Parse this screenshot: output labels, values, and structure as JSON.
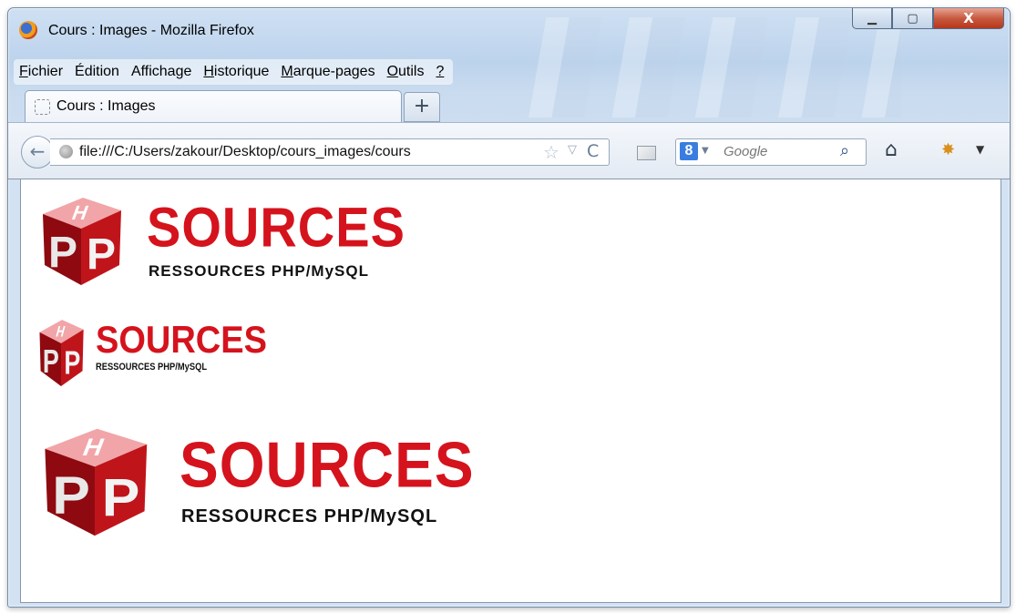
{
  "window": {
    "title": "Cours : Images - Mozilla Firefox",
    "minimize_symbol": "▁",
    "maximize_symbol": "▢",
    "close_symbol": "X"
  },
  "menubar": {
    "items": [
      {
        "label_u": "F",
        "label_rest": "ichier"
      },
      {
        "label_u": "É",
        "label_rest": "dition"
      },
      {
        "label_u": "A",
        "label_rest": "ffichage"
      },
      {
        "label_u": "H",
        "label_rest": "istorique"
      },
      {
        "label_u": "M",
        "label_rest": "arque-pages"
      },
      {
        "label_u": "O",
        "label_rest": "utils"
      },
      {
        "label_u": "?",
        "label_rest": ""
      }
    ]
  },
  "tab": {
    "label": "Cours : Images",
    "new_tab_symbol": "+"
  },
  "navbar": {
    "url": "file:///C:/Users/zakour/Desktop/cours_images/cours",
    "search_engine_letter": "8",
    "search_placeholder": "Google",
    "back_symbol": "←",
    "star_symbol": "☆",
    "dropdown_symbol": "▽",
    "reload_symbol": "C",
    "search_symbol": "⚲",
    "home_symbol": "⌂"
  },
  "content": {
    "logos": [
      {
        "letter_left": "P",
        "letter_right": "P",
        "letter_top": "H",
        "brand": "SOURCES",
        "tagline": "RESSOURCES PHP/MySQL"
      },
      {
        "letter_left": "P",
        "letter_right": "P",
        "letter_top": "H",
        "brand": "SOURCES",
        "tagline": "RESSOURCES PHP/MySQL"
      },
      {
        "letter_left": "P",
        "letter_right": "P",
        "letter_top": "H",
        "brand": "SOURCES",
        "tagline": "RESSOURCES PHP/MySQL"
      }
    ]
  },
  "colors": {
    "brand_red": "#d5131d",
    "cube_dark_red": "#8e0a10",
    "cube_mid_red": "#c0141b",
    "window_frame": "#bcd3ec"
  }
}
